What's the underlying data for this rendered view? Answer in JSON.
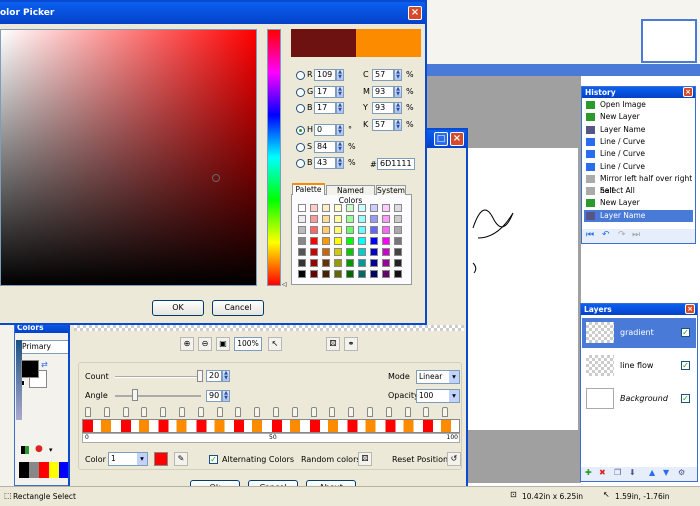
{
  "color_picker": {
    "title": "olor Picker",
    "fields": [
      {
        "label": "R",
        "value": "109"
      },
      {
        "label": "G",
        "value": "17"
      },
      {
        "label": "B",
        "value": "17"
      },
      {
        "label": "H",
        "value": "0"
      },
      {
        "label": "S",
        "value": "84"
      },
      {
        "label": "B",
        "value": "43"
      }
    ],
    "cmyk": [
      {
        "label": "C",
        "value": "57"
      },
      {
        "label": "M",
        "value": "93"
      },
      {
        "label": "Y",
        "value": "93"
      },
      {
        "label": "K",
        "value": "57"
      }
    ],
    "percent": "%",
    "degree": "°",
    "hash": "#",
    "hex": "6D1111",
    "tabs": [
      "Palette",
      "Named Colors",
      "System"
    ],
    "ok": "OK",
    "cancel": "Cancel",
    "old_color": "#6d1111",
    "new_color": "#fd8b00"
  },
  "gradient": {
    "count_label": "Count",
    "count_value": "20",
    "angle_label": "Angle",
    "angle_value": "90",
    "mode_label": "Mode",
    "mode_value": "Linear",
    "opacity_label": "Opacity",
    "opacity_value": "100",
    "zoom": "100%",
    "scale_0": "0",
    "scale_50": "50",
    "scale_100": "100",
    "color_label": "Color",
    "color_value": "1",
    "alternating": "Alternating Colors",
    "random": "Random colors",
    "reset": "Reset Positions",
    "ok": "Ok",
    "cancel": "Cancel",
    "about": "About"
  },
  "history": {
    "title": "History",
    "items": [
      "Open Image",
      "New Layer",
      "Layer Name",
      "Line / Curve",
      "Line / Curve",
      "Line / Curve",
      "Mirror left half over right half",
      "Select All",
      "New Layer",
      "Layer Name"
    ],
    "selected_index": 9
  },
  "layers": {
    "title": "Layers",
    "items": [
      "gradient",
      "line flow",
      "Background"
    ]
  },
  "colors_panel": {
    "title": "Colors",
    "mode": "Primary"
  },
  "status": {
    "tool": "Rectangle Select",
    "size": "10.42in x 6.25in",
    "pos": "1.59in, -1.76in"
  }
}
